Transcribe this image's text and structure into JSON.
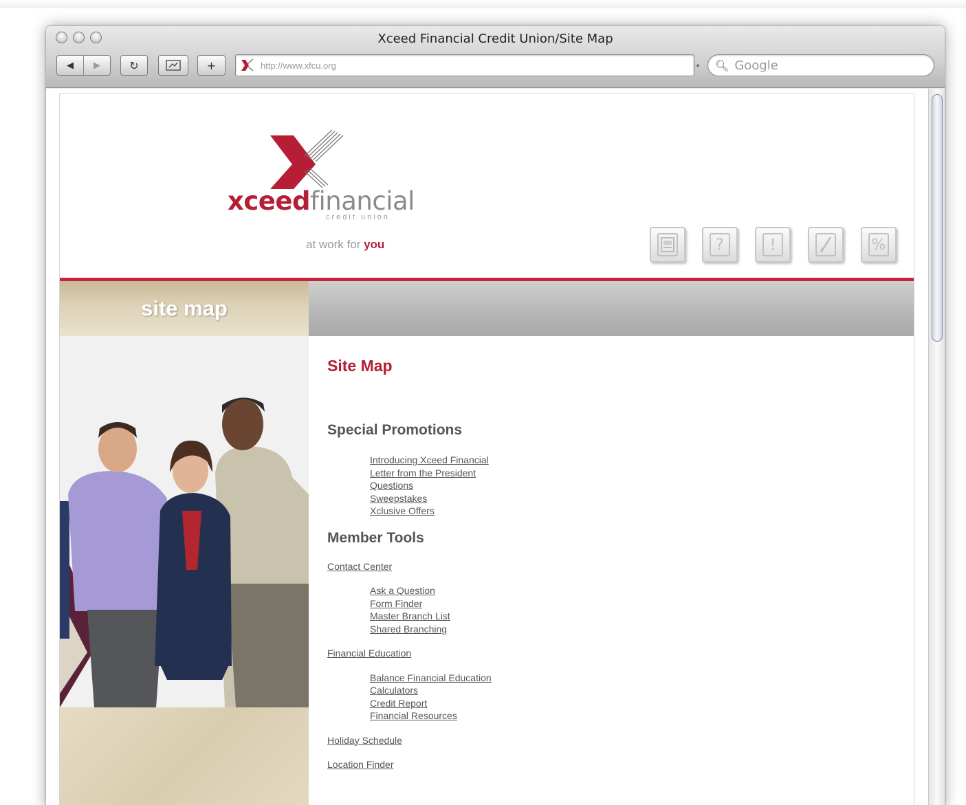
{
  "browser": {
    "title": "Xceed Financial Credit Union/Site Map",
    "url": "http://www.xfcu.org",
    "search_placeholder": "Google",
    "buttons": {
      "back": "◀",
      "forward": "▶",
      "reload": "↻",
      "add_bookmark": "+"
    }
  },
  "brand": {
    "name_bold": "xceed",
    "name_light": "financial",
    "subtitle": "credit union",
    "tagline_prefix": "at work for ",
    "tagline_emphasis": "you"
  },
  "header_icons": [
    "document-icon",
    "question-icon",
    "alert-icon",
    "pen-icon",
    "percent-icon"
  ],
  "banner": {
    "title": "site map"
  },
  "main": {
    "title": "Site Map",
    "special_promotions": {
      "heading": "Special Promotions",
      "links": [
        "Introducing Xceed Financial",
        "Letter from the President",
        "Questions",
        "Sweepstakes",
        "Xclusive Offers"
      ]
    },
    "member_tools": {
      "heading": "Member Tools",
      "contact_center": {
        "label": "Contact Center",
        "links": [
          "Ask a Question",
          "Form Finder",
          "Master Branch List",
          "Shared Branching"
        ]
      },
      "financial_education": {
        "label": "Financial Education",
        "links": [
          "Balance Financial Education",
          "Calculators",
          "Credit Report",
          "Financial Resources"
        ]
      },
      "holiday_schedule": "Holiday Schedule",
      "location_finder": "Location Finder"
    }
  },
  "colors": {
    "brand_red": "#b51e35",
    "banner_beige": "#d8ccb0",
    "banner_gray": "#b5b5b5"
  }
}
